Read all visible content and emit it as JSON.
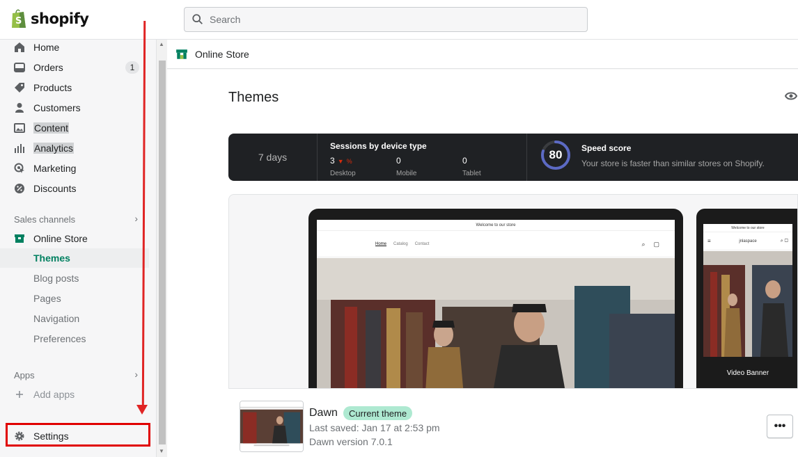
{
  "brand": {
    "name": "shopify",
    "accent": "#008060"
  },
  "search": {
    "placeholder": "Search"
  },
  "sidebar": {
    "items": [
      {
        "label": "Home",
        "icon": "home-icon"
      },
      {
        "label": "Orders",
        "icon": "orders-icon",
        "badge": "1"
      },
      {
        "label": "Products",
        "icon": "tag-icon"
      },
      {
        "label": "Customers",
        "icon": "person-icon"
      },
      {
        "label": "Content",
        "icon": "content-icon"
      },
      {
        "label": "Analytics",
        "icon": "analytics-icon"
      },
      {
        "label": "Marketing",
        "icon": "marketing-icon"
      },
      {
        "label": "Discounts",
        "icon": "discount-icon"
      }
    ],
    "sales_channels_label": "Sales channels",
    "online_store_label": "Online Store",
    "store_sub": [
      "Themes",
      "Blog posts",
      "Pages",
      "Navigation",
      "Preferences"
    ],
    "apps_label": "Apps",
    "add_apps_label": "Add apps",
    "settings_label": "Settings"
  },
  "main": {
    "breadcrumb": "Online Store",
    "title": "Themes",
    "stats": {
      "period": "7 days",
      "sessions_title": "Sessions by device type",
      "desktop_value": "3",
      "desktop_change": "%",
      "desktop_label": "Desktop",
      "mobile_value": "0",
      "mobile_label": "Mobile",
      "tablet_value": "0",
      "tablet_label": "Tablet",
      "speed_score": "80",
      "speed_score_value": 80,
      "speed_title": "Speed score",
      "speed_desc": "Your store is faster than similar stores on Shopify."
    },
    "preview": {
      "announcement": "Welcome to our store",
      "nav_links": [
        "Home",
        "Catalog",
        "Contact"
      ],
      "phone_store_name": "jn​laspace",
      "phone_caption": "Video Banner"
    },
    "theme": {
      "name": "Dawn",
      "badge": "Current theme",
      "saved": "Last saved: Jan 17 at 2:53 pm",
      "version": "Dawn version 7.0.1",
      "more_label": "•••"
    }
  }
}
